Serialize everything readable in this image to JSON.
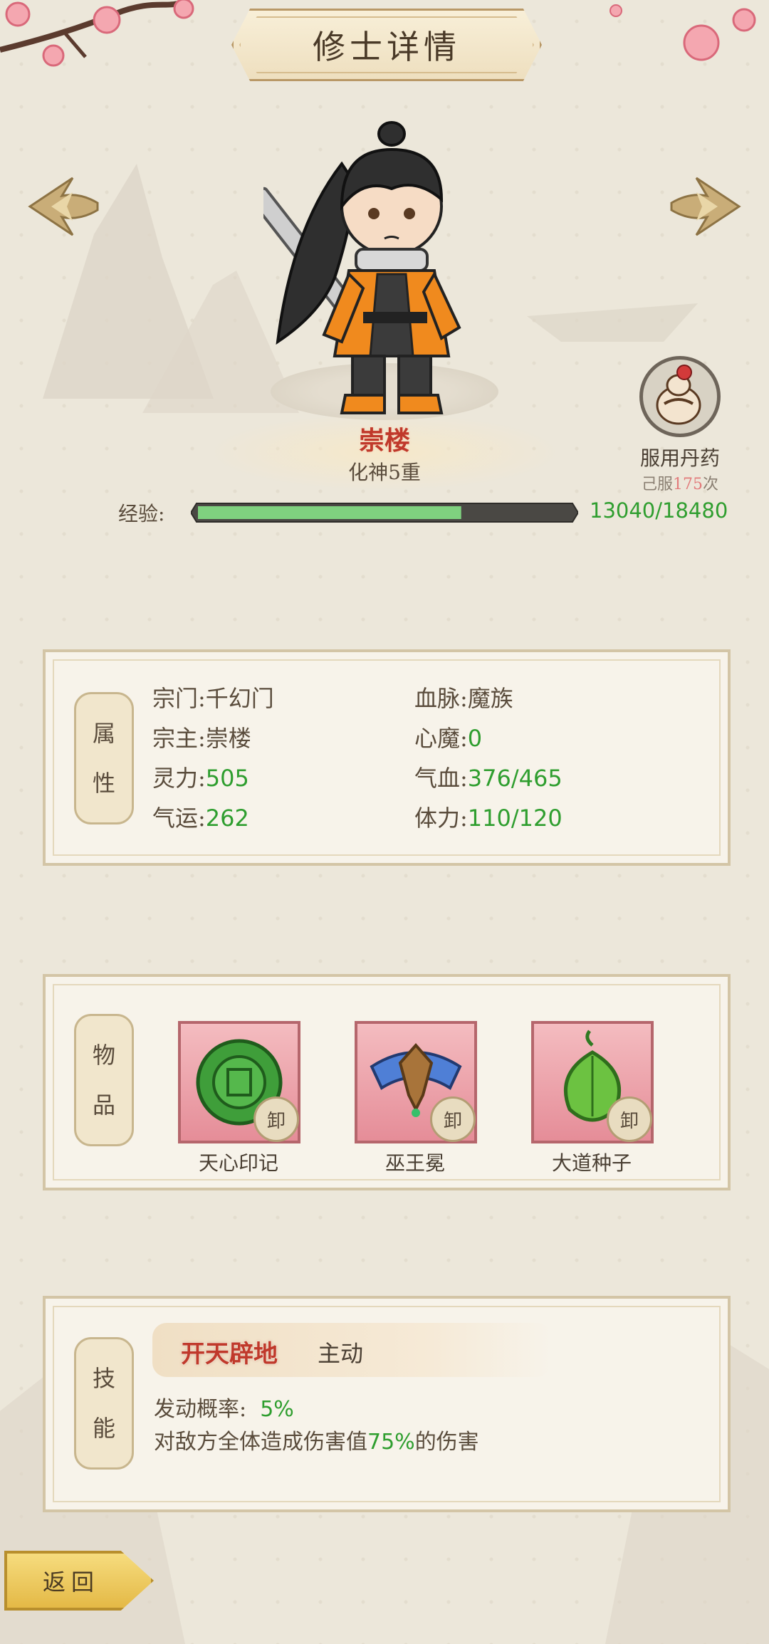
{
  "header": {
    "title": "修士详情"
  },
  "nav": {
    "prev_icon": "arrow-left-icon",
    "next_icon": "arrow-right-icon"
  },
  "hero": {
    "name": "崇楼",
    "rank": "化神5重"
  },
  "pill": {
    "label": "服用丹药",
    "count_prefix": "己服",
    "count": "175",
    "count_suffix": "次"
  },
  "exp": {
    "label": "经验:",
    "value": "13040/18480",
    "progress": 0.7056
  },
  "attributes": {
    "tab_chars": [
      "属",
      "性"
    ],
    "sect_label": "宗门:",
    "sect_value": "千幻门",
    "bloodline_label": "血脉:",
    "bloodline_value": "魔族",
    "master_label": "宗主:",
    "master_value": "崇楼",
    "demon_label": "心魔:",
    "demon_value": "0",
    "spirit_label": "灵力:",
    "spirit_value": "505",
    "hp_label": "气血:",
    "hp_value": "376/465",
    "luck_label": "气运:",
    "luck_value": "262",
    "stamina_label": "体力:",
    "stamina_value": "110/120"
  },
  "items": {
    "tab_chars": [
      "物",
      "品"
    ],
    "unequip_label": "卸",
    "list": [
      {
        "name": "天心印记",
        "icon": "jade-seal-icon"
      },
      {
        "name": "巫王冕",
        "icon": "crown-icon"
      },
      {
        "name": "大道种子",
        "icon": "seed-icon"
      }
    ]
  },
  "skill": {
    "tab_chars": [
      "技",
      "能"
    ],
    "name": "开天辟地",
    "type": "主动",
    "chance_label": "发动概率:",
    "chance_value": "5%",
    "desc_prefix": "对敌方全体造成伤害值",
    "desc_value": "75%",
    "desc_suffix": "的伤害"
  },
  "footer": {
    "back_label": "返回"
  }
}
